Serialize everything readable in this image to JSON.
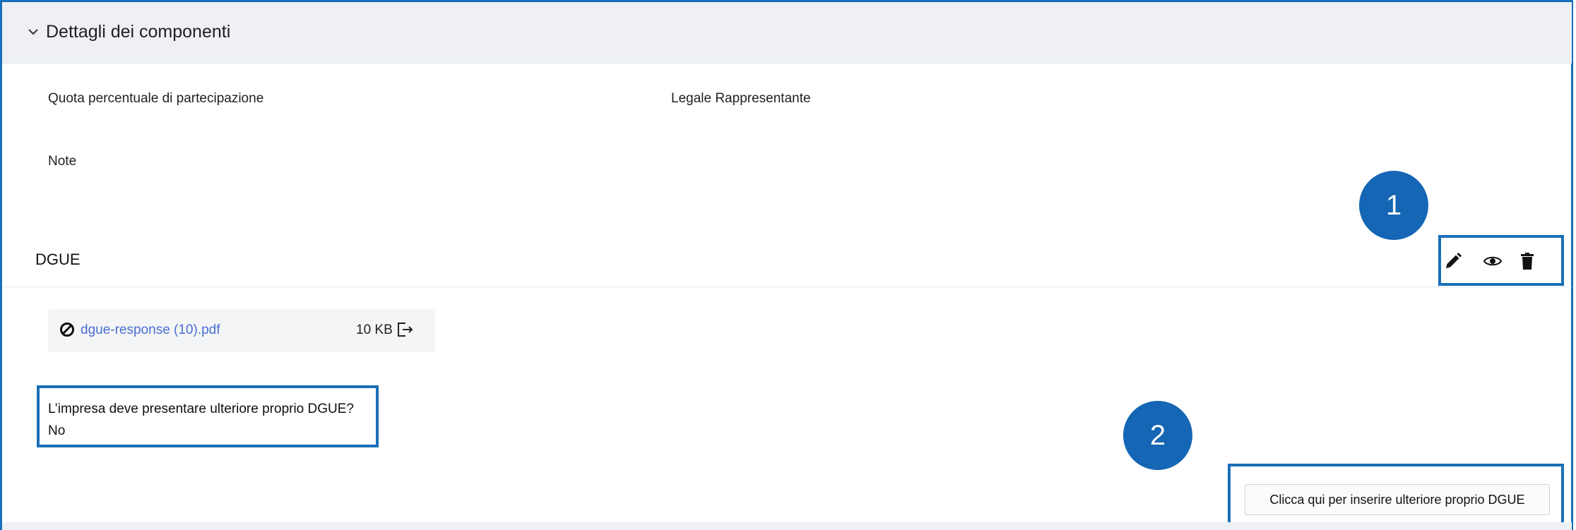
{
  "section": {
    "title": "Dettagli dei componenti",
    "chevron_icon": "chevron-down-icon"
  },
  "fields": {
    "quota_label": "Quota percentuale di partecipazione",
    "legale_label": "Legale Rappresentante",
    "note_label": "Note"
  },
  "dgue": {
    "title": "DGUE",
    "actions": [
      "edit-icon",
      "view-icon",
      "delete-icon"
    ],
    "file": {
      "name": "dgue-response (10).pdf",
      "size": "10 KB",
      "status_icon": "ban-icon",
      "export_icon": "export-icon"
    },
    "question": "L’impresa deve presentare ulteriore proprio DGUE?",
    "answer": "No",
    "add_button_label": "Clicca qui per inserire ulteriore proprio DGUE"
  },
  "callouts": {
    "badge_1": "1",
    "badge_2": "2",
    "highlight_color": "#1a6fb8",
    "badge_color": "#1566b4"
  }
}
